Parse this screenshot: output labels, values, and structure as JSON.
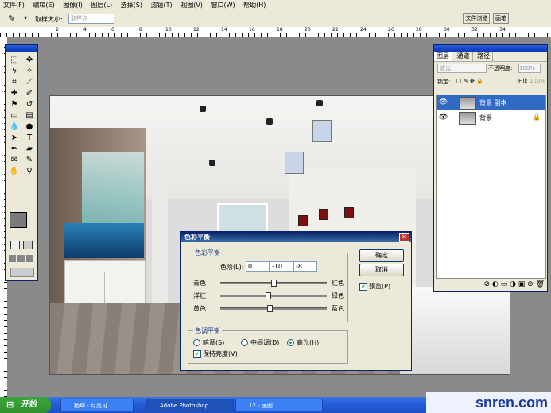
{
  "menu": [
    "文件(F)",
    "编辑(E)",
    "图像(I)",
    "图层(L)",
    "选择(S)",
    "滤镜(T)",
    "视图(V)",
    "窗口(W)",
    "帮助(H)"
  ],
  "options": {
    "sample_size_label": "取样大小:",
    "sample_size_value": "取样点"
  },
  "well_buttons": [
    "文件浏览",
    "画笔"
  ],
  "ruler_numbers": [
    "2",
    "4",
    "6",
    "8",
    "10",
    "12",
    "14",
    "16",
    "18",
    "20",
    "22",
    "24",
    "26",
    "28",
    "30",
    "32",
    "34"
  ],
  "layers_panel": {
    "tabs": [
      "图层",
      "通道",
      "路径"
    ],
    "blend_mode": "滤光",
    "opacity_label": "不透明度:",
    "opacity_value": "100%",
    "lock_label": "锁定:",
    "fill_label": "Fill:",
    "fill_value": "100%",
    "layers": [
      {
        "name": "背景 副本",
        "selected": true
      },
      {
        "name": "背景",
        "selected": false
      }
    ]
  },
  "dialog": {
    "title": "色彩平衡",
    "group_color_balance": "色彩平衡",
    "levels_label": "色阶(L):",
    "levels": [
      "0",
      "-10",
      "-8"
    ],
    "sliders": [
      {
        "left": "青色",
        "right": "红色",
        "value": 0
      },
      {
        "left": "洋红",
        "right": "绿色",
        "value": -10
      },
      {
        "left": "黄色",
        "right": "蓝色",
        "value": -8
      }
    ],
    "group_tone": "色调平衡",
    "tones": [
      "暗调(S)",
      "中间调(D)",
      "高光(H)"
    ],
    "tone_selected": "高光(H)",
    "preserve_luminosity": "保持亮度(V)",
    "ok": "确定",
    "cancel": "取消",
    "preview": "预览(P)"
  },
  "taskbar": {
    "start": "开始",
    "tasks": [
      "杨坤 - 月亮可...",
      "Adobe Photoshop",
      "12 - 画图"
    ]
  },
  "watermark": "snren.com"
}
